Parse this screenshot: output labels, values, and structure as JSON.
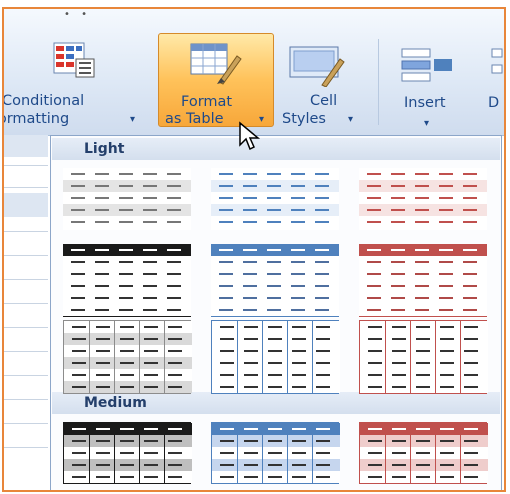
{
  "ribbon": {
    "conditional_formatting": {
      "line1": "Conditional",
      "line2": "Formatting",
      "caret": "▾"
    },
    "format_as_table": {
      "line1": "Format",
      "line2": "as Table",
      "caret": "▾"
    },
    "cell_styles": {
      "line1": "Cell",
      "line2": "Styles",
      "caret": "▾"
    },
    "insert": {
      "label": "Insert",
      "caret": "▾"
    },
    "next_button": {
      "label": "D"
    }
  },
  "gallery": {
    "sections": [
      {
        "label": "Light"
      },
      {
        "label": "Medium"
      }
    ],
    "theme_colors": {
      "black": "#1a1a1a",
      "blue": "#4f81bd",
      "red": "#c0504d",
      "gray": "#8c8c8c"
    }
  },
  "accent_color": "#e8863a"
}
